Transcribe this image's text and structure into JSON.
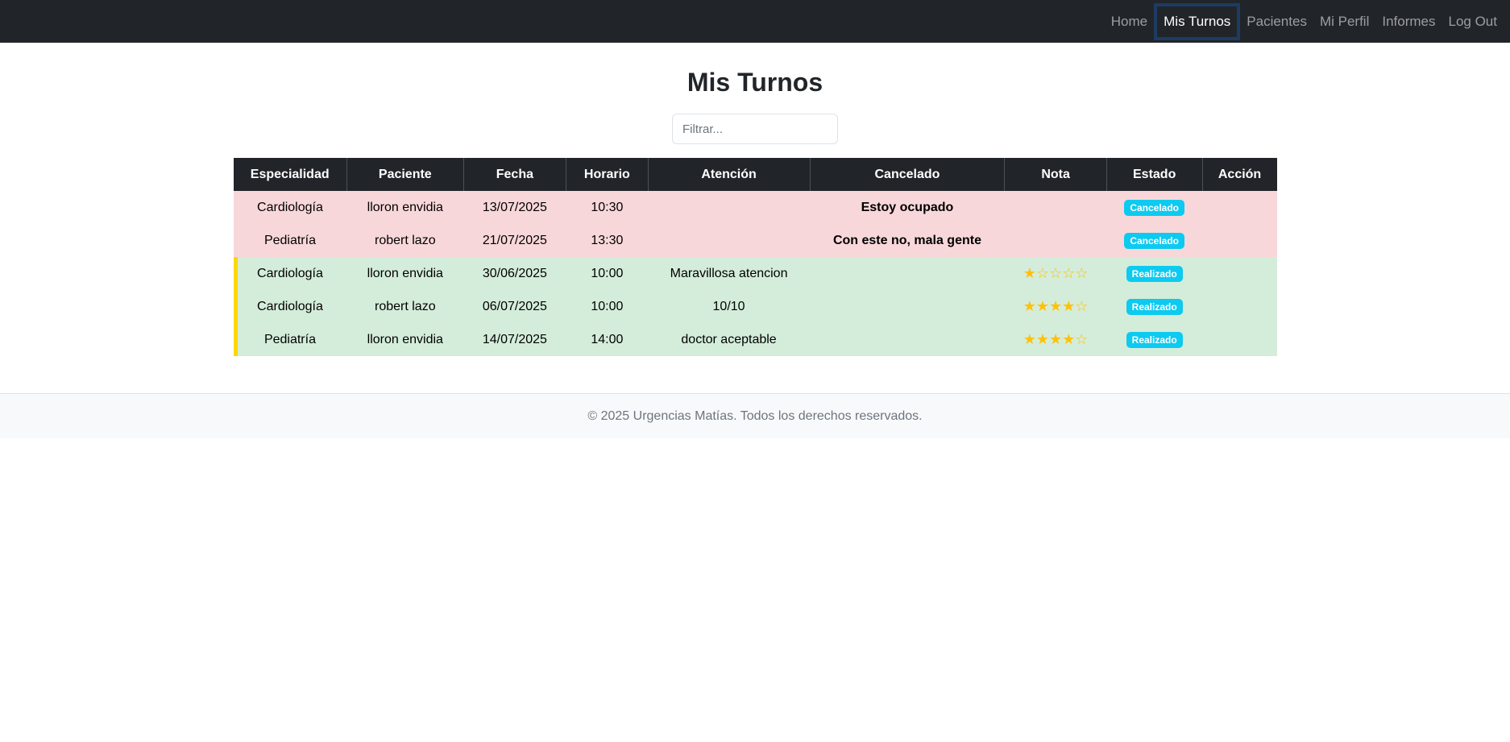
{
  "nav": {
    "items": [
      {
        "label": "Home",
        "active": false
      },
      {
        "label": "Mis Turnos",
        "active": true
      },
      {
        "label": "Pacientes",
        "active": false
      },
      {
        "label": "Mi Perfil",
        "active": false
      },
      {
        "label": "Informes",
        "active": false
      },
      {
        "label": "Log Out",
        "active": false
      }
    ]
  },
  "page": {
    "title": "Mis Turnos"
  },
  "filter": {
    "placeholder": "Filtrar..."
  },
  "table": {
    "headers": [
      "Especialidad",
      "Paciente",
      "Fecha",
      "Horario",
      "Atención",
      "Cancelado",
      "Nota",
      "Estado",
      "Acción"
    ],
    "rows": [
      {
        "status": "cancelled",
        "especialidad": "Cardiología",
        "paciente": "lloron envidia",
        "fecha": "13/07/2025",
        "horario": "10:30",
        "atencion": "",
        "cancelado": "Estoy ocupado",
        "nota": "",
        "estado": "Cancelado",
        "accion": ""
      },
      {
        "status": "cancelled",
        "especialidad": "Pediatría",
        "paciente": "robert lazo",
        "fecha": "21/07/2025",
        "horario": "13:30",
        "atencion": "",
        "cancelado": "Con este no, mala gente",
        "nota": "",
        "estado": "Cancelado",
        "accion": ""
      },
      {
        "status": "done",
        "especialidad": "Cardiología",
        "paciente": "lloron envidia",
        "fecha": "30/06/2025",
        "horario": "10:00",
        "atencion": "Maravillosa atencion",
        "cancelado": "",
        "nota": "★☆☆☆☆",
        "estado": "Realizado",
        "accion": ""
      },
      {
        "status": "done",
        "especialidad": "Cardiología",
        "paciente": "robert lazo",
        "fecha": "06/07/2025",
        "horario": "10:00",
        "atencion": "10/10",
        "cancelado": "",
        "nota": "★★★★☆",
        "estado": "Realizado",
        "accion": ""
      },
      {
        "status": "done",
        "especialidad": "Pediatría",
        "paciente": "lloron envidia",
        "fecha": "14/07/2025",
        "horario": "14:00",
        "atencion": "doctor aceptable",
        "cancelado": "",
        "nota": "★★★★☆",
        "estado": "Realizado",
        "accion": ""
      }
    ]
  },
  "footer": {
    "text": "© 2025 Urgencias Matías. Todos los derechos reservados."
  },
  "colors": {
    "navbar": "#212529",
    "cancelled_row": "#f8d7da",
    "done_row": "#d4edda",
    "badge": "#0dcaf0",
    "star": "#ffc107",
    "accent_border": "#ffd700"
  }
}
